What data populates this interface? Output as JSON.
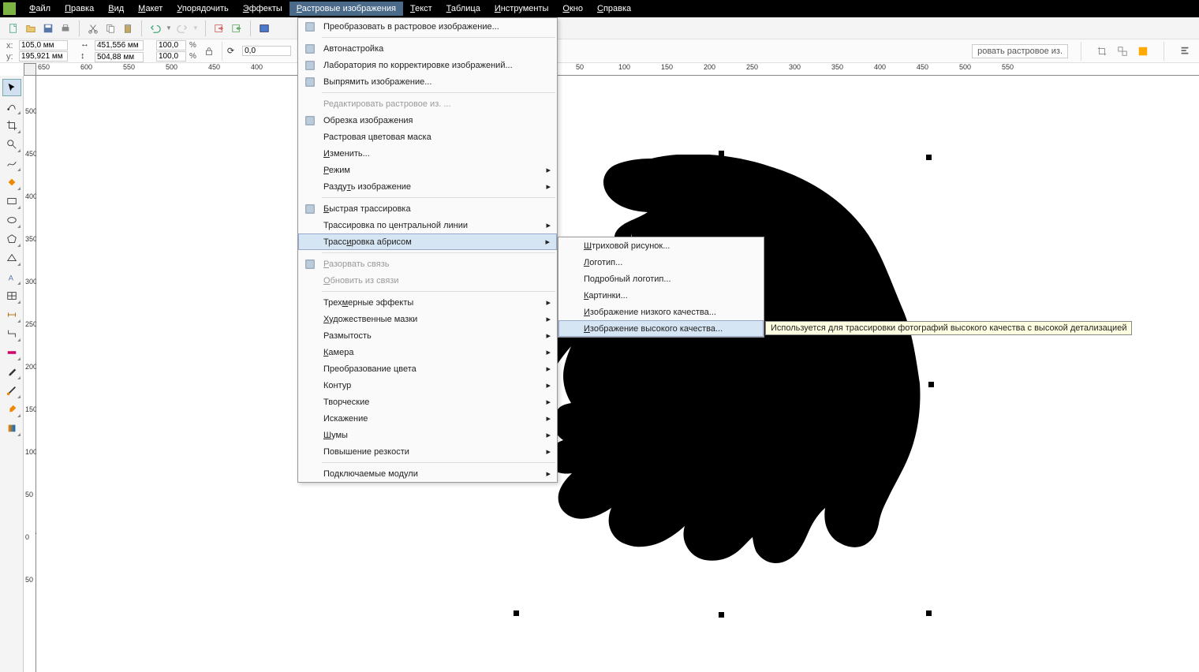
{
  "menubar": {
    "items": [
      "Файл",
      "Правка",
      "Вид",
      "Макет",
      "Упорядочить",
      "Эффекты",
      "Растровые изображения",
      "Текст",
      "Таблица",
      "Инструменты",
      "Окно",
      "Справка"
    ],
    "active_index": 6
  },
  "propbar": {
    "x_label": "x:",
    "x_value": "105,0 мм",
    "y_label": "y:",
    "y_value": "195,921 мм",
    "w_value": "451,556 мм",
    "h_value": "504,88 мм",
    "sx": "100,0",
    "sy": "100,0",
    "pct": "%",
    "rotate": "0,0",
    "trace_btn_text": "ровать растровое из."
  },
  "ruler_h": [
    "650",
    "600",
    "550",
    "500",
    "450",
    "400",
    "50",
    "100",
    "150",
    "200",
    "250",
    "300",
    "350",
    "400",
    "450",
    "500",
    "550"
  ],
  "ruler_h_pos": [
    18,
    72,
    126,
    180,
    234,
    288,
    702,
    756,
    810,
    864,
    918,
    972,
    1026,
    1080,
    1134,
    1188,
    1242,
    1296,
    1350,
    1404
  ],
  "ruler_h_labels": [
    "650",
    "600",
    "550",
    "500",
    "450",
    "400",
    "50",
    "100",
    "150",
    "200",
    "250",
    "300",
    "350",
    "400",
    "450",
    "500",
    "550"
  ],
  "ruler_v": [
    "500",
    "450",
    "400",
    "350",
    "300",
    "250",
    "200",
    "150",
    "100",
    "50",
    "0",
    "50"
  ],
  "dropdown1": {
    "items": [
      {
        "t": "Преобразовать в растровое изображение...",
        "icon": "convert"
      },
      {
        "sep": true
      },
      {
        "t": "Автонастройка",
        "icon": "auto"
      },
      {
        "t": "Лаборатория по корректировке изображений...",
        "icon": "lab"
      },
      {
        "t": "Выпрямить изображение...",
        "icon": "straighten"
      },
      {
        "sep": true
      },
      {
        "t": "Редактировать растровое из. ...",
        "disabled": true
      },
      {
        "t": "Обрезка изображения",
        "icon": "crop"
      },
      {
        "t": "Растровая цветовая маска"
      },
      {
        "t": "Изменить...",
        "u": 0
      },
      {
        "t": "Режим",
        "sub": true,
        "u": 0
      },
      {
        "t": "Раздуть изображение",
        "sub": true,
        "u": 5
      },
      {
        "sep": true
      },
      {
        "t": "Быстрая трассировка",
        "icon": "quicktrace",
        "u": 0
      },
      {
        "t": "Трассировка по центральной линии",
        "sub": true
      },
      {
        "t": "Трассировка абрисом",
        "sub": true,
        "hover": true,
        "u": 5
      },
      {
        "sep": true
      },
      {
        "t": "Разорвать связь",
        "disabled": true,
        "icon": "break",
        "u": 0
      },
      {
        "t": "Обновить из связи",
        "disabled": true,
        "u": 0
      },
      {
        "sep": true
      },
      {
        "t": "Трехмерные эффекты",
        "sub": true,
        "u": 4
      },
      {
        "t": "Художественные мазки",
        "sub": true,
        "u": 0
      },
      {
        "t": "Размытость",
        "sub": true
      },
      {
        "t": "Камера",
        "sub": true,
        "u": 0
      },
      {
        "t": "Преобразование цвета",
        "sub": true
      },
      {
        "t": "Контур",
        "sub": true
      },
      {
        "t": "Творческие",
        "sub": true
      },
      {
        "t": "Искажение",
        "sub": true
      },
      {
        "t": "Шумы",
        "sub": true,
        "u": 0
      },
      {
        "t": "Повышение резкости",
        "sub": true
      },
      {
        "sep": true
      },
      {
        "t": "Подключаемые модули",
        "sub": true
      }
    ]
  },
  "dropdown2": {
    "items": [
      {
        "t": "Штриховой рисунок...",
        "u": 0
      },
      {
        "t": "Логотип...",
        "u": 0
      },
      {
        "t": "Подробный логотип..."
      },
      {
        "t": "Картинки...",
        "u": 0
      },
      {
        "t": "Изображение низкого качества...",
        "u": 0
      },
      {
        "t": "Изображение высокого качества...",
        "hover": true,
        "u": 0
      }
    ]
  },
  "tooltip": "Используется для трассировки фотографий высокого качества с высокой детализацией"
}
